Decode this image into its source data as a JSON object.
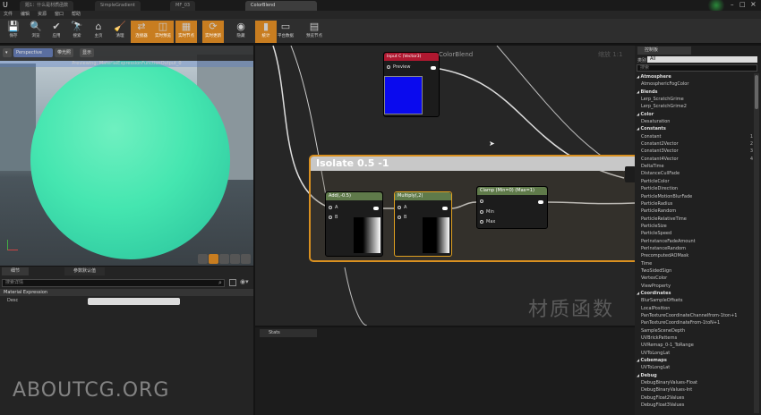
{
  "tabs": [
    "题1：什么是材质函数",
    "SimpleGradient",
    "MF_03",
    "ColorBlend"
  ],
  "menu": [
    "文件",
    "编辑",
    "资源",
    "窗口",
    "帮助"
  ],
  "toolbar": [
    {
      "label": "保存",
      "icon": "save-icon",
      "glyph": "💾",
      "hl": false
    },
    {
      "label": "浏览",
      "icon": "browse-icon",
      "glyph": "🔍",
      "hl": false
    },
    {
      "label": "应用",
      "icon": "apply-icon",
      "glyph": "✔",
      "hl": false
    },
    {
      "label": "搜索",
      "icon": "search-icon",
      "glyph": "🔭",
      "hl": false
    },
    {
      "label": "主页",
      "icon": "home-icon",
      "glyph": "⌂",
      "hl": false
    },
    {
      "label": "清理",
      "icon": "clean-icon",
      "glyph": "🧹",
      "hl": false
    },
    {
      "label": "连接器",
      "icon": "connectors-icon",
      "glyph": "⇄",
      "hl": true
    },
    {
      "label": "实时预览",
      "icon": "live-preview-icon",
      "glyph": "◫",
      "hl": true
    },
    {
      "label": "实时节点",
      "icon": "live-nodes-icon",
      "glyph": "▦",
      "hl": true
    },
    {
      "label": "实时更新",
      "icon": "live-update-icon",
      "glyph": "⟳",
      "hl": true
    },
    {
      "label": "隐藏",
      "icon": "hide-icon",
      "glyph": "◉",
      "hl": false
    },
    {
      "label": "统计",
      "icon": "stats-icon",
      "glyph": "▮",
      "hl": true
    },
    {
      "label": "平台数据",
      "icon": "platform-stats-icon",
      "glyph": "▭",
      "hl": false
    },
    {
      "label": "预览节点",
      "icon": "preview-node-icon",
      "glyph": "▤",
      "hl": false
    }
  ],
  "viewport": {
    "perspective": "Perspective",
    "lit": "带光照",
    "show": "显示",
    "preview": "Previewing: MaterialExpressionFunctionOutput_0"
  },
  "details": {
    "tab1": "细节",
    "tab2": "参数默认值",
    "search_placeholder": "搜索详情",
    "section": "Material Expression",
    "desc_label": "Desc"
  },
  "watermark": "ABOUTCG.ORG",
  "graph": {
    "wm": "材质函数",
    "zoom": "缩放 1:1",
    "input_node": {
      "title": "Input C (Vector3)",
      "pin": "Preview",
      "caption": "ColorBlend"
    },
    "comment": "Isolate 0.5 -1",
    "add": {
      "title": "Add(,-0.5)",
      "a": "A",
      "b": "B"
    },
    "multiply": {
      "title": "Multiply(,2)",
      "a": "A",
      "b": "B"
    },
    "clamp": {
      "title": "Clamp (Min=0) (Max=1)",
      "min": "Min",
      "max": "Max"
    }
  },
  "stats": {
    "tab": "Stats"
  },
  "palette": {
    "tab": "控制板",
    "category_label": "类别",
    "category_value": "All",
    "search_placeholder": "搜索",
    "items": [
      {
        "t": "Atmosphere",
        "cat": true
      },
      {
        "t": "AtmosphericFogColor"
      },
      {
        "t": "Blends",
        "cat": true
      },
      {
        "t": "Lerp_ScratchGrime"
      },
      {
        "t": "Lerp_ScratchGrime2"
      },
      {
        "t": "Color",
        "cat": true
      },
      {
        "t": "Desaturation"
      },
      {
        "t": "Constants",
        "cat": true
      },
      {
        "t": "Constant",
        "k": "1"
      },
      {
        "t": "Constant2Vector",
        "k": "2"
      },
      {
        "t": "Constant3Vector",
        "k": "3"
      },
      {
        "t": "Constant4Vector",
        "k": "4"
      },
      {
        "t": "DeltaTime"
      },
      {
        "t": "DistanceCullFade"
      },
      {
        "t": "ParticleColor"
      },
      {
        "t": "ParticleDirection"
      },
      {
        "t": "ParticleMotionBlurFade"
      },
      {
        "t": "ParticleRadius"
      },
      {
        "t": "ParticleRandom"
      },
      {
        "t": "ParticleRelativeTime"
      },
      {
        "t": "ParticleSize"
      },
      {
        "t": "ParticleSpeed"
      },
      {
        "t": "PerInstanceFadeAmount"
      },
      {
        "t": "PerInstanceRandom"
      },
      {
        "t": "PrecomputedAOMask"
      },
      {
        "t": "Time"
      },
      {
        "t": "TwoSidedSign"
      },
      {
        "t": "VertexColor"
      },
      {
        "t": "ViewProperty"
      },
      {
        "t": "Coordinates",
        "cat": true
      },
      {
        "t": "BlurSampleOffsets"
      },
      {
        "t": "LocalPosition"
      },
      {
        "t": "PanTextureCoordinateChannelfrom-1ton+1"
      },
      {
        "t": "PanTextureCoordinateFrom-1toN+1"
      },
      {
        "t": "SampleSceneDepth"
      },
      {
        "t": "UVBrickPatterns"
      },
      {
        "t": "UVRemap_0-1_ToRange"
      },
      {
        "t": "UVToLongLat"
      },
      {
        "t": "Cubemaps",
        "cat": true
      },
      {
        "t": "UVToLongLat"
      },
      {
        "t": "Debug",
        "cat": true
      },
      {
        "t": "DebugBinaryValues-Float"
      },
      {
        "t": "DebugBinaryValues-Int"
      },
      {
        "t": "DebugFloat2Values"
      },
      {
        "t": "DebugFloat3Values"
      }
    ]
  }
}
